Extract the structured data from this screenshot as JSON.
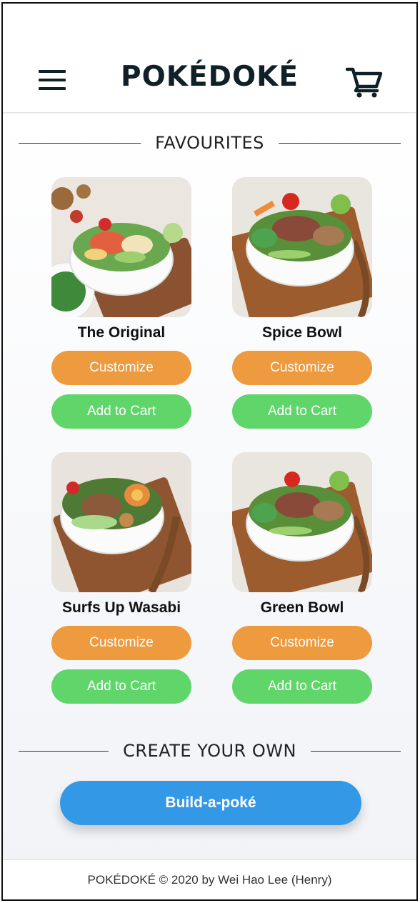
{
  "header": {
    "brand": "POKÉDOKÉ",
    "menu_icon": "hamburger-menu-icon",
    "cart_icon": "shopping-cart-icon"
  },
  "favourites": {
    "heading": "FAVOURITES",
    "items": [
      {
        "name": "The Original",
        "customize_label": "Customize",
        "add_label": "Add to Cart"
      },
      {
        "name": "Spice Bowl",
        "customize_label": "Customize",
        "add_label": "Add to Cart"
      },
      {
        "name": "Surfs Up Wasabi",
        "customize_label": "Customize",
        "add_label": "Add to Cart"
      },
      {
        "name": "Green Bowl",
        "customize_label": "Customize",
        "add_label": "Add to Cart"
      }
    ]
  },
  "create": {
    "heading": "CREATE YOUR OWN",
    "build_label": "Build-a-poké"
  },
  "footer": {
    "text": "POKÉDOKÉ © 2020 by Wei Hao Lee (Henry)"
  },
  "colors": {
    "brand": "#0f2028",
    "customize": "#ee9a3f",
    "add_to_cart": "#5fd56a",
    "build": "#3399e6"
  }
}
